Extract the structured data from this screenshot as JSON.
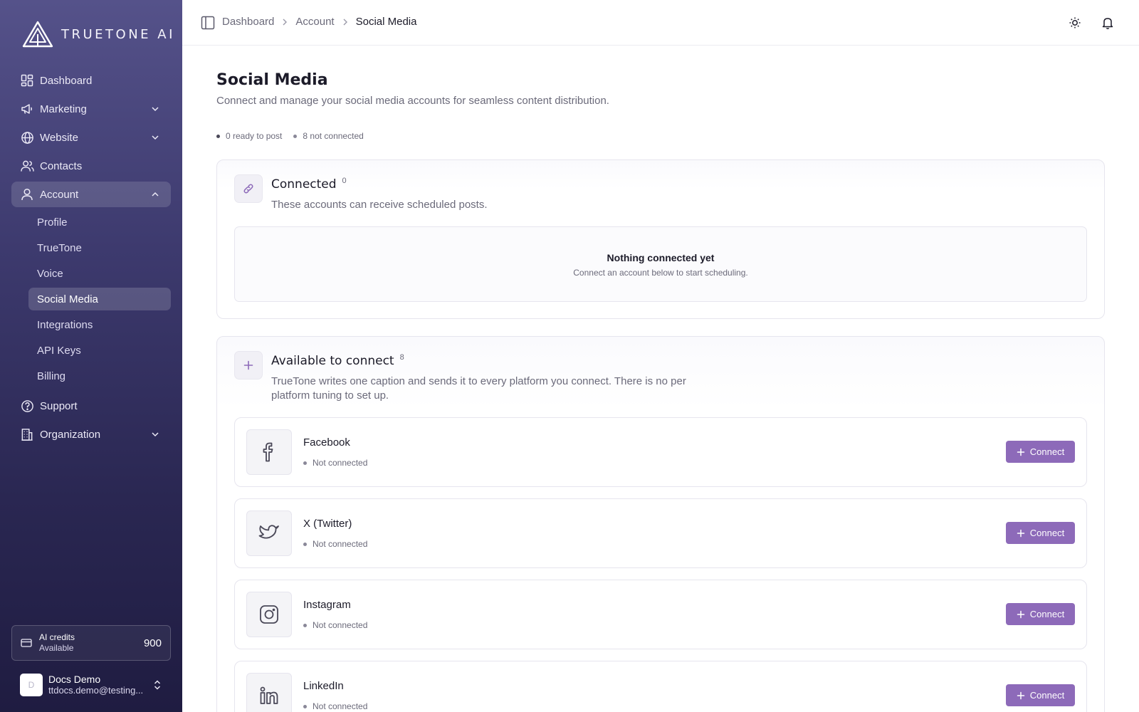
{
  "brand": {
    "name": "TRUETONE AI"
  },
  "sidebar": {
    "nav": [
      {
        "label": "Dashboard",
        "icon": "dashboard-grid-icon"
      },
      {
        "label": "Marketing",
        "icon": "megaphone-icon"
      },
      {
        "label": "Website",
        "icon": "globe-icon"
      },
      {
        "label": "Contacts",
        "icon": "users-icon"
      },
      {
        "label": "Account",
        "icon": "user-icon"
      },
      {
        "label": "Support",
        "icon": "help-circle-icon"
      },
      {
        "label": "Organization",
        "icon": "building-icon"
      }
    ],
    "account_sub": [
      {
        "label": "Profile"
      },
      {
        "label": "TrueTone"
      },
      {
        "label": "Voice"
      },
      {
        "label": "Social Media"
      },
      {
        "label": "Integrations"
      },
      {
        "label": "API Keys"
      },
      {
        "label": "Billing"
      }
    ],
    "credits": {
      "title": "AI credits",
      "subtitle": "Available",
      "value": "900"
    },
    "user": {
      "initial": "D",
      "name": "Docs Demo",
      "email": "ttdocs.demo@testing..."
    }
  },
  "topbar": {
    "breadcrumbs": [
      "Dashboard",
      "Account",
      "Social Media"
    ]
  },
  "page": {
    "title": "Social Media",
    "description": "Connect and manage your social media accounts for seamless content distribution.",
    "stats": [
      "0 ready to post",
      "8 not connected"
    ]
  },
  "connected": {
    "title": "Connected",
    "count": "0",
    "description": "These accounts can receive scheduled posts.",
    "empty_title": "Nothing connected yet",
    "empty_subtitle": "Connect an account below to start scheduling."
  },
  "available": {
    "title": "Available to connect",
    "count": "8",
    "description": "TrueTone writes one caption and sends it to every platform you connect. There is no per platform tuning to set up.",
    "platforms": [
      {
        "name": "Facebook",
        "status": "Not connected",
        "button": "Connect",
        "icon": "facebook-icon"
      },
      {
        "name": "X (Twitter)",
        "status": "Not connected",
        "button": "Connect",
        "icon": "twitter-bird-icon"
      },
      {
        "name": "Instagram",
        "status": "Not connected",
        "button": "Connect",
        "icon": "instagram-icon"
      },
      {
        "name": "LinkedIn",
        "status": "Not connected",
        "button": "Connect",
        "icon": "linkedin-icon"
      }
    ]
  },
  "colors": {
    "accent": "#8d6ab9",
    "sidebar_top": "#55528a",
    "sidebar_bottom": "#1f1c41"
  }
}
